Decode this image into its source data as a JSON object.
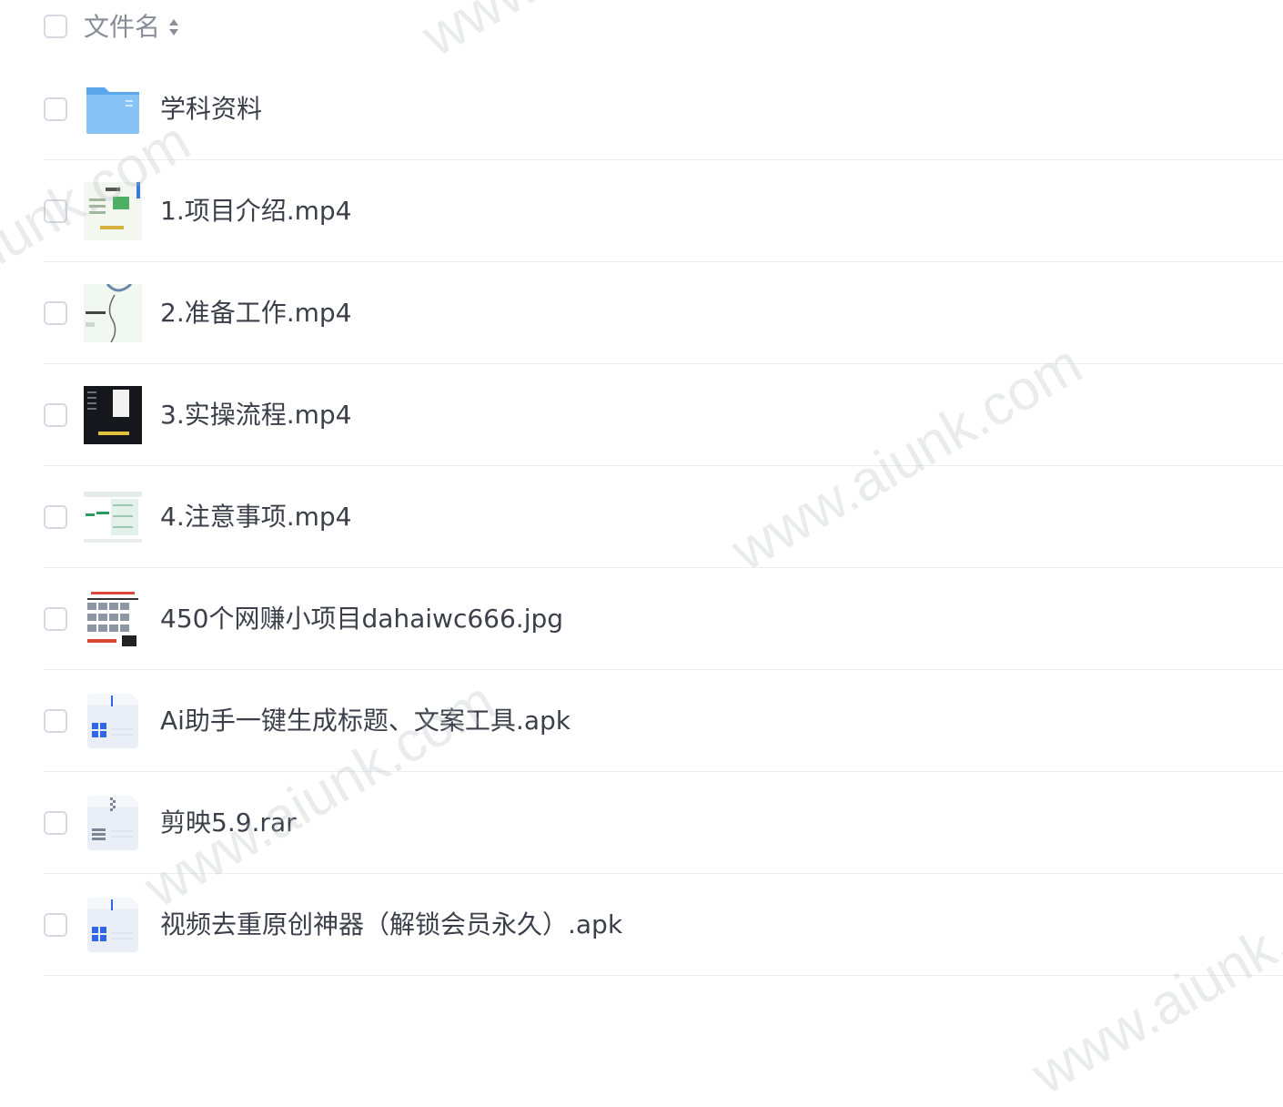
{
  "header": {
    "label": "文件名"
  },
  "files": [
    {
      "name": "学科资料",
      "kind": "folder",
      "icon": "folder-icon"
    },
    {
      "name": "1.项目介绍.mp4",
      "kind": "video-green",
      "icon": "video-thumbnail"
    },
    {
      "name": "2.准备工作.mp4",
      "kind": "video-mind",
      "icon": "video-thumbnail"
    },
    {
      "name": "3.实操流程.mp4",
      "kind": "video-dark",
      "icon": "video-thumbnail"
    },
    {
      "name": "4.注意事项.mp4",
      "kind": "video-table",
      "icon": "video-thumbnail"
    },
    {
      "name": "450个网赚小项目dahaiwc666.jpg",
      "kind": "image",
      "icon": "image-thumbnail"
    },
    {
      "name": "Ai助手一键生成标题、文案工具.apk",
      "kind": "apk",
      "icon": "apk-file-icon"
    },
    {
      "name": "剪映5.9.rar",
      "kind": "rar",
      "icon": "archive-file-icon"
    },
    {
      "name": "视频去重原创神器（解锁会员永久）.apk",
      "kind": "apk",
      "icon": "apk-file-icon"
    }
  ],
  "watermark": {
    "text": "www.aiunk.com"
  },
  "colors": {
    "folder": "#6fb6f0",
    "apk_accent": "#2f66e6",
    "divider": "#eceef2"
  }
}
